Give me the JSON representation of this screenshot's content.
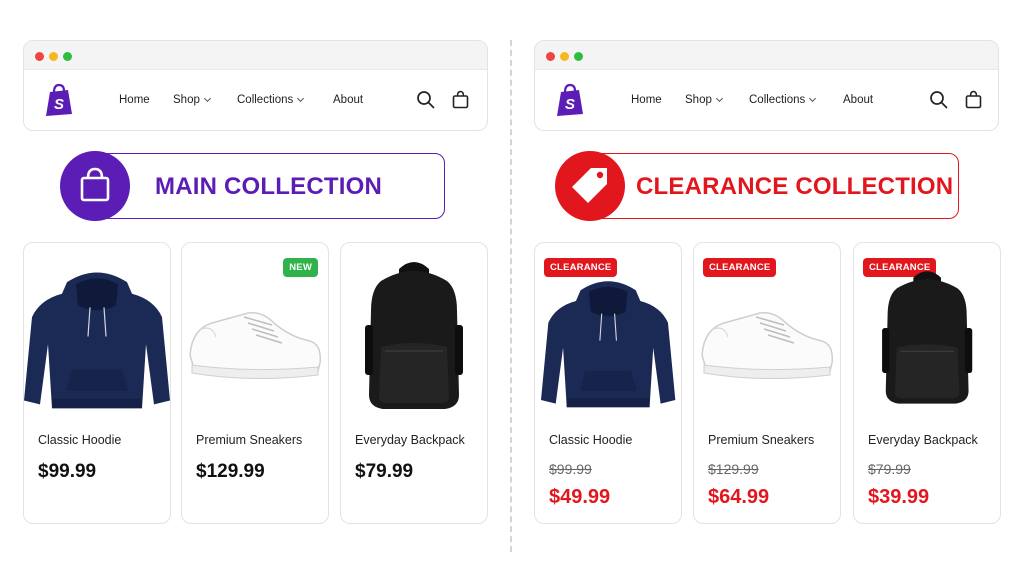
{
  "colors": {
    "main_accent": "#5b1db5",
    "clearance_accent": "#e2171e",
    "new_badge": "#2fb34a",
    "shopify_logo": "#5b1db5"
  },
  "nav": {
    "home": "Home",
    "shop": "Shop",
    "collections": "Collections",
    "about": "About",
    "icons": [
      "shopify-logo-icon",
      "search-icon",
      "shopping-bag-icon"
    ]
  },
  "main": {
    "banner_title": "MAIN COLLECTION",
    "banner_icon": "shopping-bag-icon",
    "products": [
      {
        "name": "Classic Hoodie",
        "price": "$99.99",
        "badge": ""
      },
      {
        "name": "Premium Sneakers",
        "price": "$129.99",
        "badge": "NEW"
      },
      {
        "name": "Everyday Backpack",
        "price": "$79.99",
        "badge": ""
      }
    ]
  },
  "clearance": {
    "banner_title": "CLEARANCE COLLECTION",
    "banner_icon": "price-tag-icon",
    "products": [
      {
        "name": "Classic Hoodie",
        "original_price": "$99.99",
        "sale_price": "$49.99",
        "badge": "CLEARANCE"
      },
      {
        "name": "Premium Sneakers",
        "original_price": "$129.99",
        "sale_price": "$64.99",
        "badge": "CLEARANCE"
      },
      {
        "name": "Everyday Backpack",
        "original_price": "$79.99",
        "sale_price": "$39.99",
        "badge": "CLEARANCE"
      }
    ]
  }
}
